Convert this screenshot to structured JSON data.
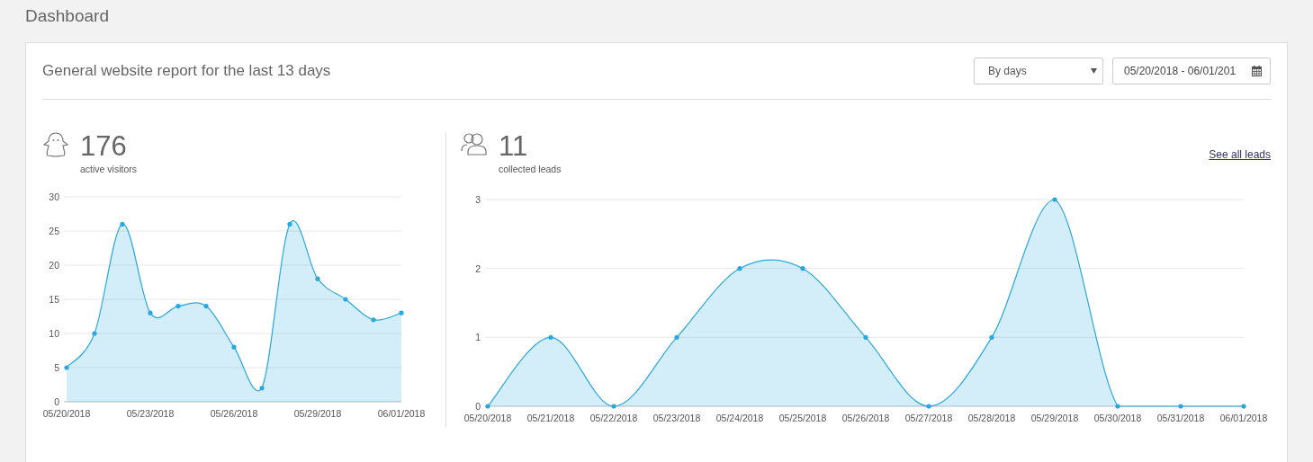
{
  "page_title": "Dashboard",
  "report": {
    "title": "General website report for the last 13 days",
    "period_select": {
      "value": "By days"
    },
    "date_range": {
      "value": "05/20/2018 - 06/01/201"
    }
  },
  "panels": [
    {
      "kind": "visitors",
      "count": "176",
      "label": "active visitors",
      "chart_data": {
        "type": "area",
        "grid": true,
        "series": [
          {
            "color": "#29a8e0",
            "values": [
              5,
              10,
              26,
              13,
              14,
              14,
              8,
              2,
              26,
              18,
              15,
              12,
              13
            ]
          }
        ],
        "ylim": [
          0,
          30
        ],
        "yticks": [
          0,
          5,
          10,
          15,
          20,
          25,
          30
        ],
        "categories": [
          "05/20/2018",
          null,
          null,
          "05/23/2018",
          null,
          null,
          "05/26/2018",
          null,
          null,
          "05/29/2018",
          null,
          null,
          "06/01/2018"
        ]
      }
    },
    {
      "kind": "leads",
      "count": "11",
      "label": "collected leads",
      "link": "See all leads",
      "chart_data": {
        "type": "area",
        "grid": true,
        "categories": [
          "05/20/2018",
          "05/21/2018",
          "05/22/2018",
          "05/23/2018",
          "05/24/2018",
          "05/25/2018",
          "05/26/2018",
          "05/27/2018",
          "05/28/2018",
          "05/29/2018",
          "05/30/2018",
          "05/31/2018",
          "06/01/2018"
        ],
        "series": [
          {
            "color": "#29a8e0",
            "values": [
              0,
              1,
              0,
              1,
              2,
              2,
              1,
              0,
              1,
              3,
              0,
              0,
              0
            ]
          }
        ],
        "ylim": [
          0,
          3
        ],
        "yticks": [
          0,
          1,
          2,
          3
        ]
      }
    }
  ]
}
